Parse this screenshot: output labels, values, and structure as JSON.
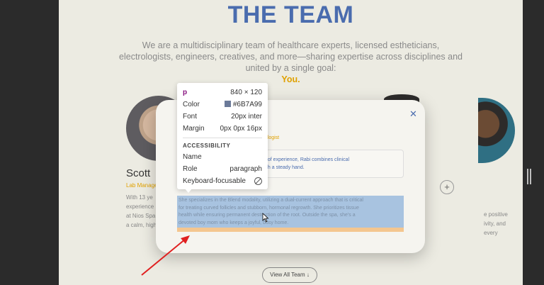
{
  "page": {
    "title": "THE TEAM",
    "intro": "We are a multidisciplinary team of healthcare experts, licensed estheticians, electrologists, engineers, creatives, and more—sharing expertise across disciplines and united by a single goal:",
    "intro_accent": "You.",
    "view_all_label": "View All Team ↓",
    "plus_label": "+"
  },
  "cards": {
    "scott": {
      "name": "Scott",
      "role": "Lab Manage",
      "bio": [
        "With 13 ye",
        "experience",
        "at Nios Spa,",
        "a calm, high"
      ]
    },
    "right_bio": [
      "e positive",
      "ivity, and",
      "every"
    ]
  },
  "modal": {
    "close_icon": "close-icon",
    "name": "bi",
    "role": "Electrologist",
    "quote_line1": "6 years of experience, Rabi combines clinical",
    "quote_line2": "ision with a steady hand.",
    "paragraph_lines": [
      "She specializes in the Blend modality, utilizing a dual-current approach that is critical",
      "for treating curved follicles and stubborn, hormonal regrowth. She prioritizes tissue",
      "health while ensuring permanent destruction of the root. Outside the spa, she's a",
      "devoted boy mom who keeps a joyful, busy home."
    ]
  },
  "inspector": {
    "tag": "p",
    "size": "840 × 120",
    "color_label": "Color",
    "color_value": "#6B7A99",
    "font_label": "Font",
    "font_value": "20px inter",
    "margin_label": "Margin",
    "margin_value": "0px 0px 16px",
    "section": "ACCESSIBILITY",
    "name_label": "Name",
    "name_value": "",
    "role_label": "Role",
    "role_value": "paragraph",
    "kbd_label": "Keyboard-focusable",
    "kbd_icon": "not-focusable-icon"
  },
  "colors": {
    "brand_blue": "#4a6cae",
    "accent_gold": "#e0a100",
    "highlight_content": "#a8c3e0",
    "highlight_margin": "#f4c68f",
    "annotation_arrow": "#e02020"
  }
}
